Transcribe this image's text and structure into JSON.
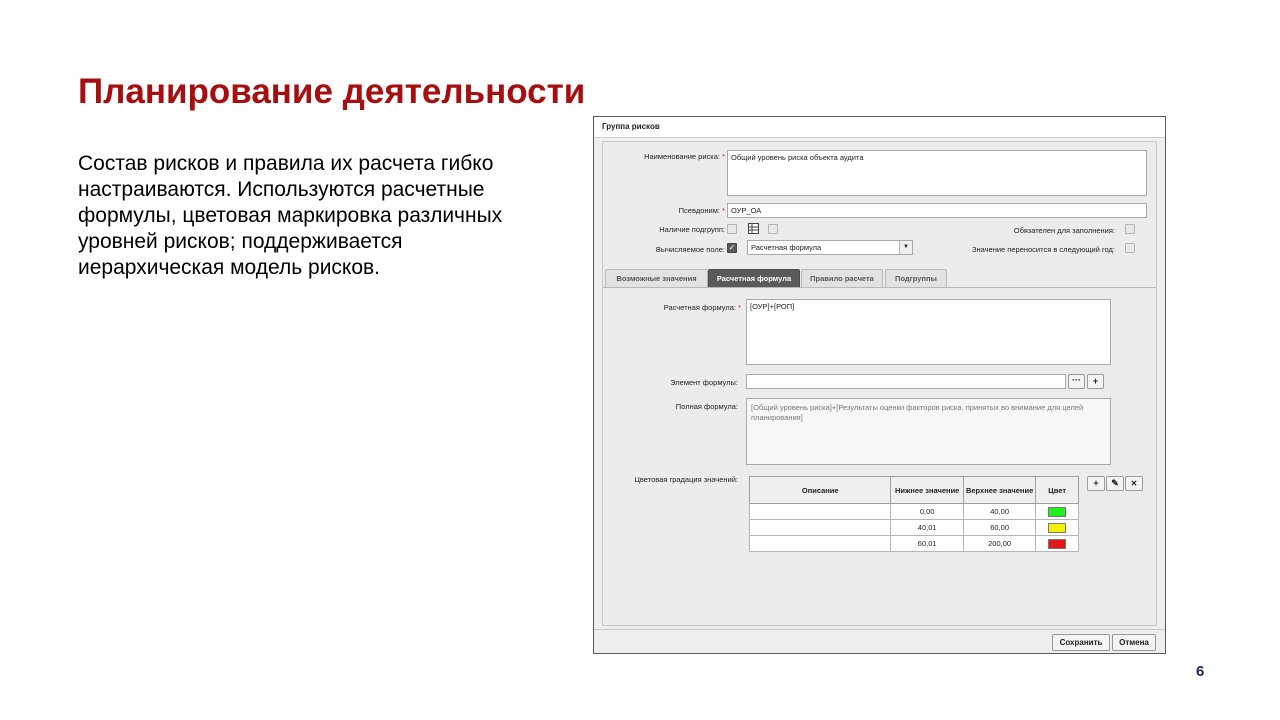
{
  "slide": {
    "title": "Планирование деятельности",
    "body": "Состав рисков и правила их расчета гибко настраиваются. Используются расчетные формулы, цветовая маркировка различных уровней рисков; поддерживается иерархическая модель рисков.",
    "page_number": "6"
  },
  "window": {
    "title": "Группа рисков",
    "fields": {
      "risk_name_label": "Наименование риска:",
      "risk_name_value": "Общий уровень риска объекта аудита",
      "alias_label": "Псевдоним:",
      "alias_value": "ОУР_ОА",
      "subgroups_label": "Наличие подгрупп:",
      "required_label": "Обязателен для заполнения:",
      "computed_label": "Вычисляемое поле:",
      "computed_select": "Расчетная формула",
      "carry_label": "Значение переносится в следующий год:",
      "required_mark": "*"
    },
    "tabs": [
      {
        "label": "Возможные значения"
      },
      {
        "label": "Расчетная формула"
      },
      {
        "label": "Правило расчета"
      },
      {
        "label": "Подгруппы"
      }
    ],
    "formula": {
      "formula_label": "Расчетная формула:",
      "formula_value": "[ОУР]+[РОП]",
      "element_label": "Элемент формулы:",
      "element_value": "",
      "ellipsis_btn": "···",
      "add_btn": "+",
      "full_label": "Полная формула:",
      "full_value": "[Общий уровень риска]+[Результаты оценки факторов риска, принятых во внимание для целей планирования]"
    },
    "gradation": {
      "label": "Цветовая градация значений:",
      "headers": [
        "Описание",
        "Нижнее значение",
        "Верхнее значение",
        "Цвет"
      ],
      "rows": [
        {
          "description": "",
          "low": "0,00",
          "high": "40,00",
          "color": "#22ee22"
        },
        {
          "description": "",
          "low": "40,01",
          "high": "60,00",
          "color": "#f2f200"
        },
        {
          "description": "",
          "low": "60,01",
          "high": "200,00",
          "color": "#e01818"
        }
      ],
      "tool_add": "+",
      "tool_edit": "✎",
      "tool_delete": "✕"
    },
    "footer": {
      "save": "Сохранить",
      "cancel": "Отмена"
    }
  }
}
